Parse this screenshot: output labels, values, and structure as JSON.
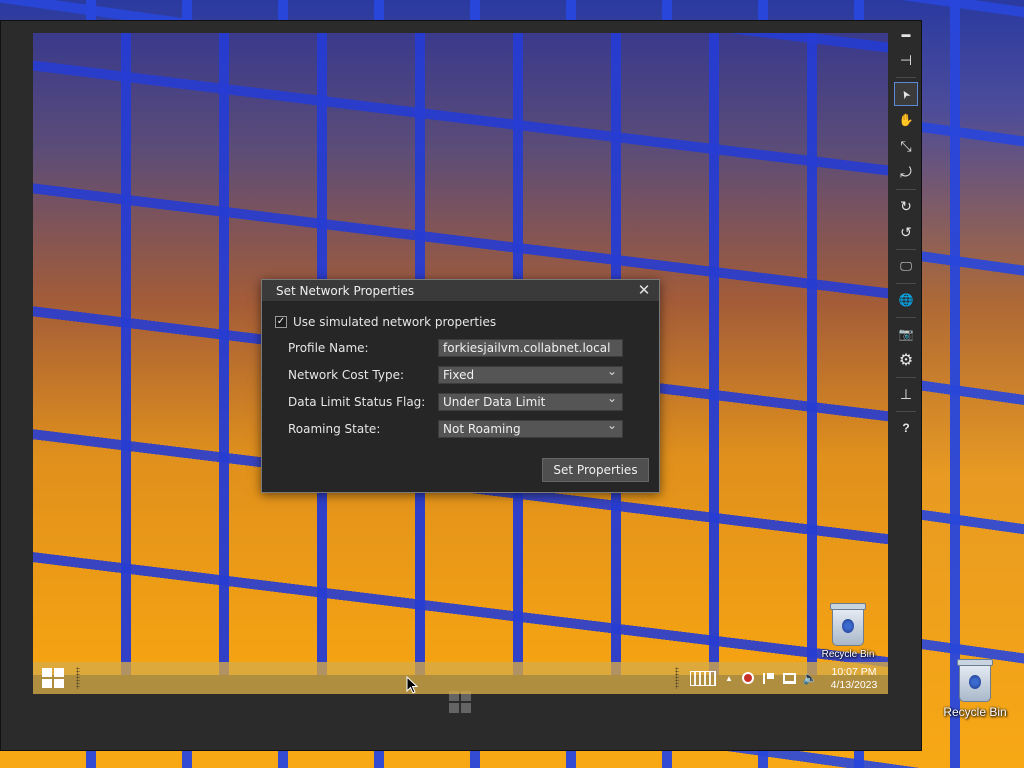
{
  "host": {
    "recycle_bin_label": "Recycle Bin"
  },
  "vm_toolbar": {
    "buttons": [
      {
        "name": "minimize-icon",
        "glyph": "▬"
      },
      {
        "name": "pin-icon",
        "glyph": "⊣"
      },
      {
        "name": "pointer-icon",
        "glyph": "➤"
      },
      {
        "name": "hand-icon",
        "glyph": "✋"
      },
      {
        "name": "pinch-icon",
        "glyph": "⤡"
      },
      {
        "name": "swipe-icon",
        "glyph": "⤾"
      },
      {
        "name": "rotate-clockwise-icon",
        "glyph": "↻"
      },
      {
        "name": "rotate-counterclockwise-icon",
        "glyph": "↺"
      },
      {
        "name": "monitor-icon",
        "glyph": "🖵"
      },
      {
        "name": "globe-icon",
        "glyph": "🌐"
      },
      {
        "name": "camera-icon",
        "glyph": "📷"
      },
      {
        "name": "gear-icon",
        "glyph": "⚙"
      },
      {
        "name": "network-icon",
        "glyph": "⊥"
      },
      {
        "name": "help-icon",
        "glyph": "?"
      }
    ]
  },
  "dialog": {
    "title": "Set Network Properties",
    "close_glyph": "✕",
    "use_simulated_label": "Use simulated network properties",
    "use_simulated_checked": "✓",
    "profile_name_label": "Profile Name:",
    "profile_name_value": "forkiesjailvm.collabnet.local",
    "cost_type_label": "Network Cost Type:",
    "cost_type_value": "Fixed",
    "data_limit_label": "Data Limit Status Flag:",
    "data_limit_value": "Under Data Limit",
    "roaming_label": "Roaming State:",
    "roaming_value": "Not Roaming",
    "set_button": "Set Properties"
  },
  "vm_desktop": {
    "recycle_bin_label": "Recycle Bin"
  },
  "vm_taskbar": {
    "tray_chevron": "▲",
    "time": "10:07 PM",
    "date": "4/13/2023"
  }
}
